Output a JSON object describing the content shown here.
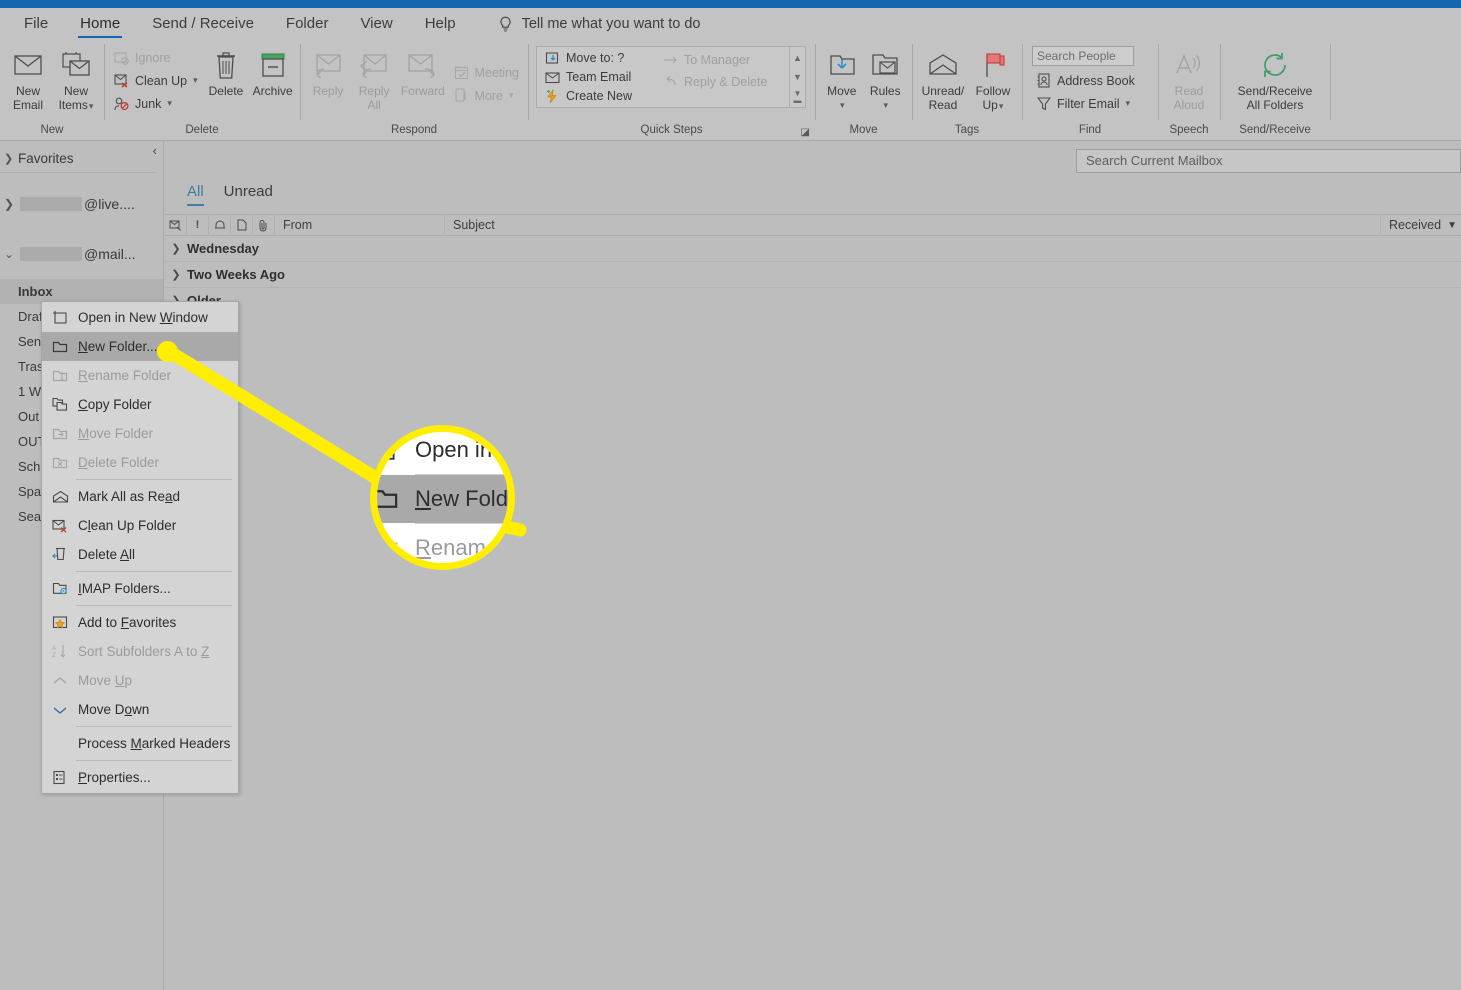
{
  "window": {
    "accent_color": "#1566b0"
  },
  "ribbon": {
    "tabs": [
      {
        "label": "File",
        "active": false
      },
      {
        "label": "Home",
        "active": true
      },
      {
        "label": "Send / Receive",
        "active": false
      },
      {
        "label": "Folder",
        "active": false
      },
      {
        "label": "View",
        "active": false
      },
      {
        "label": "Help",
        "active": false
      }
    ],
    "tell_me": {
      "icon": "lightbulb-icon",
      "label": "Tell me what you want to do"
    },
    "groups": [
      {
        "name": "New",
        "buttons": [
          {
            "label_line1": "New",
            "label_line2": "Email",
            "icon": "envelope-icon",
            "dropdown": false
          },
          {
            "label_line1": "New",
            "label_line2": "Items",
            "icon": "new-items-icon",
            "dropdown": true
          }
        ]
      },
      {
        "name": "Delete",
        "small_items": [
          {
            "label": "Ignore",
            "icon": "ignore-icon",
            "disabled": true,
            "dropdown": false
          },
          {
            "label": "Clean Up",
            "icon": "clean-up-icon",
            "disabled": false,
            "dropdown": true
          },
          {
            "label": "Junk",
            "icon": "junk-icon",
            "disabled": false,
            "dropdown": true
          }
        ],
        "buttons": [
          {
            "label_line1": "Delete",
            "label_line2": "",
            "icon": "trash-icon",
            "dropdown": false
          },
          {
            "label_line1": "Archive",
            "label_line2": "",
            "icon": "archive-icon",
            "dropdown": false
          }
        ]
      },
      {
        "name": "Respond",
        "buttons": [
          {
            "label_line1": "Reply",
            "label_line2": "",
            "icon": "reply-icon",
            "disabled": true
          },
          {
            "label_line1": "Reply",
            "label_line2": "All",
            "icon": "reply-all-icon",
            "disabled": true
          },
          {
            "label_line1": "Forward",
            "label_line2": "",
            "icon": "forward-icon",
            "disabled": true
          }
        ],
        "small_items": [
          {
            "label": "Meeting",
            "icon": "meeting-icon",
            "disabled": true,
            "dropdown": false
          },
          {
            "label": "More",
            "icon": "more-icon",
            "disabled": true,
            "dropdown": true
          }
        ]
      },
      {
        "name": "Quick Steps",
        "gallery_left": [
          {
            "label": "Move to: ?",
            "icon": "move-to-icon",
            "disabled": false
          },
          {
            "label": "Team Email",
            "icon": "team-email-icon",
            "disabled": false
          },
          {
            "label": "Create New",
            "icon": "create-new-icon",
            "disabled": false
          }
        ],
        "gallery_right": [
          {
            "label": "To Manager",
            "icon": "to-manager-icon",
            "disabled": true
          },
          {
            "label": "Reply & Delete",
            "icon": "reply-delete-icon",
            "disabled": true
          }
        ]
      },
      {
        "name": "Move",
        "buttons": [
          {
            "label_line1": "Move",
            "label_line2": "",
            "icon": "move-icon",
            "dropdown": true
          },
          {
            "label_line1": "Rules",
            "label_line2": "",
            "icon": "rules-icon",
            "dropdown": true
          }
        ]
      },
      {
        "name": "Tags",
        "buttons": [
          {
            "label_line1": "Unread/",
            "label_line2": "Read",
            "icon": "unread-read-icon",
            "dropdown": false
          },
          {
            "label_line1": "Follow",
            "label_line2": "Up",
            "icon": "follow-up-flag-icon",
            "dropdown": true
          }
        ]
      },
      {
        "name": "Find",
        "search_people_placeholder": "Search People",
        "small_items": [
          {
            "label": "Address Book",
            "icon": "address-book-icon",
            "disabled": false,
            "dropdown": false
          },
          {
            "label": "Filter Email",
            "icon": "filter-icon",
            "disabled": false,
            "dropdown": true
          }
        ]
      },
      {
        "name": "Speech",
        "buttons": [
          {
            "label_line1": "Read",
            "label_line2": "Aloud",
            "icon": "read-aloud-icon",
            "disabled": true
          }
        ]
      },
      {
        "name": "Send/Receive",
        "buttons": [
          {
            "label_line1": "Send/Receive",
            "label_line2": "All Folders",
            "icon": "send-receive-icon",
            "disabled": false
          }
        ]
      }
    ]
  },
  "sidebar": {
    "collapse_icon": "chevron-left-icon",
    "favorites_label": "Favorites",
    "accounts": [
      {
        "domain": "@live....",
        "expanded": false
      },
      {
        "domain": "@mail...",
        "expanded": true
      }
    ],
    "folders": [
      {
        "label": "Inbox",
        "selected": true
      },
      {
        "label": "Draf",
        "selected": false
      },
      {
        "label": "Sen",
        "selected": false
      },
      {
        "label": "Tras",
        "selected": false
      },
      {
        "label": "1 W",
        "selected": false
      },
      {
        "label": "Out",
        "selected": false
      },
      {
        "label": "OUT",
        "selected": false
      },
      {
        "label": "Sch",
        "selected": false
      },
      {
        "label": "Spa",
        "selected": false
      },
      {
        "label": "Sear",
        "selected": false
      }
    ]
  },
  "message_list": {
    "search_placeholder": "Search Current Mailbox",
    "filter_tabs": [
      {
        "label": "All",
        "active": true
      },
      {
        "label": "Unread",
        "active": false
      }
    ],
    "columns": [
      {
        "label": "",
        "icon": "message-status-icon"
      },
      {
        "label": "",
        "icon": "importance-icon"
      },
      {
        "label": "",
        "icon": "reminder-icon"
      },
      {
        "label": "",
        "icon": "has-attachment-page-icon"
      },
      {
        "label": "",
        "icon": "attachment-clip-icon"
      },
      {
        "label": "From",
        "icon": ""
      },
      {
        "label": "Subject",
        "icon": ""
      }
    ],
    "sort_column": {
      "label": "Received",
      "icon": "sort-descending-icon"
    },
    "groups": [
      {
        "label": "Wednesday",
        "expanded": false
      },
      {
        "label": "Two Weeks Ago",
        "expanded": false
      },
      {
        "label": "Older",
        "expanded": false
      }
    ]
  },
  "context_menu": {
    "items": [
      {
        "label": "Open in New Window",
        "accel": "W",
        "icon": "open-new-window-icon",
        "disabled": false,
        "highlighted": false,
        "separator_after": false
      },
      {
        "label": "New Folder...",
        "accel": "N",
        "icon": "new-folder-icon",
        "disabled": false,
        "highlighted": true,
        "separator_after": false
      },
      {
        "label": "Rename Folder",
        "accel": "R",
        "icon": "rename-folder-icon",
        "disabled": true,
        "highlighted": false,
        "separator_after": false
      },
      {
        "label": "Copy Folder",
        "accel": "C",
        "icon": "copy-folder-icon",
        "disabled": false,
        "highlighted": false,
        "separator_after": false
      },
      {
        "label": "Move Folder",
        "accel": "M",
        "icon": "move-folder-icon",
        "disabled": true,
        "highlighted": false,
        "separator_after": false
      },
      {
        "label": "Delete Folder",
        "accel": "D",
        "icon": "delete-folder-icon",
        "disabled": true,
        "highlighted": false,
        "separator_after": true
      },
      {
        "label": "Mark All as Read",
        "accel": "a",
        "icon": "mark-all-read-icon",
        "disabled": false,
        "highlighted": false,
        "separator_after": false
      },
      {
        "label": "Clean Up Folder",
        "accel": "l",
        "icon": "clean-up-folder-icon",
        "disabled": false,
        "highlighted": false,
        "separator_after": false
      },
      {
        "label": "Delete All",
        "accel": "A",
        "icon": "delete-all-icon",
        "disabled": false,
        "highlighted": false,
        "separator_after": true
      },
      {
        "label": "IMAP Folders...",
        "accel": "I",
        "icon": "imap-folders-icon",
        "disabled": false,
        "highlighted": false,
        "separator_after": true
      },
      {
        "label": "Add to Favorites",
        "accel": "F",
        "icon": "add-to-favorites-icon",
        "disabled": false,
        "highlighted": false,
        "separator_after": false
      },
      {
        "label": "Sort Subfolders A to Z",
        "accel": "Z",
        "icon": "sort-az-icon",
        "disabled": true,
        "highlighted": false,
        "separator_after": false
      },
      {
        "label": "Move Up",
        "accel": "U",
        "icon": "chevron-up-icon",
        "disabled": true,
        "highlighted": false,
        "separator_after": false
      },
      {
        "label": "Move Down",
        "accel": "o",
        "icon": "chevron-down-icon",
        "disabled": false,
        "highlighted": false,
        "separator_after": true
      },
      {
        "label": "Process Marked Headers",
        "accel": "M",
        "icon": "",
        "disabled": false,
        "highlighted": false,
        "separator_after": true
      },
      {
        "label": "Properties...",
        "accel": "P",
        "icon": "properties-icon",
        "disabled": false,
        "highlighted": false,
        "separator_after": false
      }
    ]
  },
  "callout": {
    "highlight_color": "#ffee00",
    "magnified_items": [
      {
        "label": "Open in N",
        "icon": "open-new-window-icon",
        "disabled": false,
        "highlighted": false
      },
      {
        "label": "New Folder.",
        "accel": "N",
        "icon": "new-folder-icon",
        "disabled": false,
        "highlighted": true
      },
      {
        "label": "Rename F",
        "accel": "R",
        "icon": "rename-folder-icon",
        "disabled": true,
        "highlighted": false
      }
    ]
  }
}
